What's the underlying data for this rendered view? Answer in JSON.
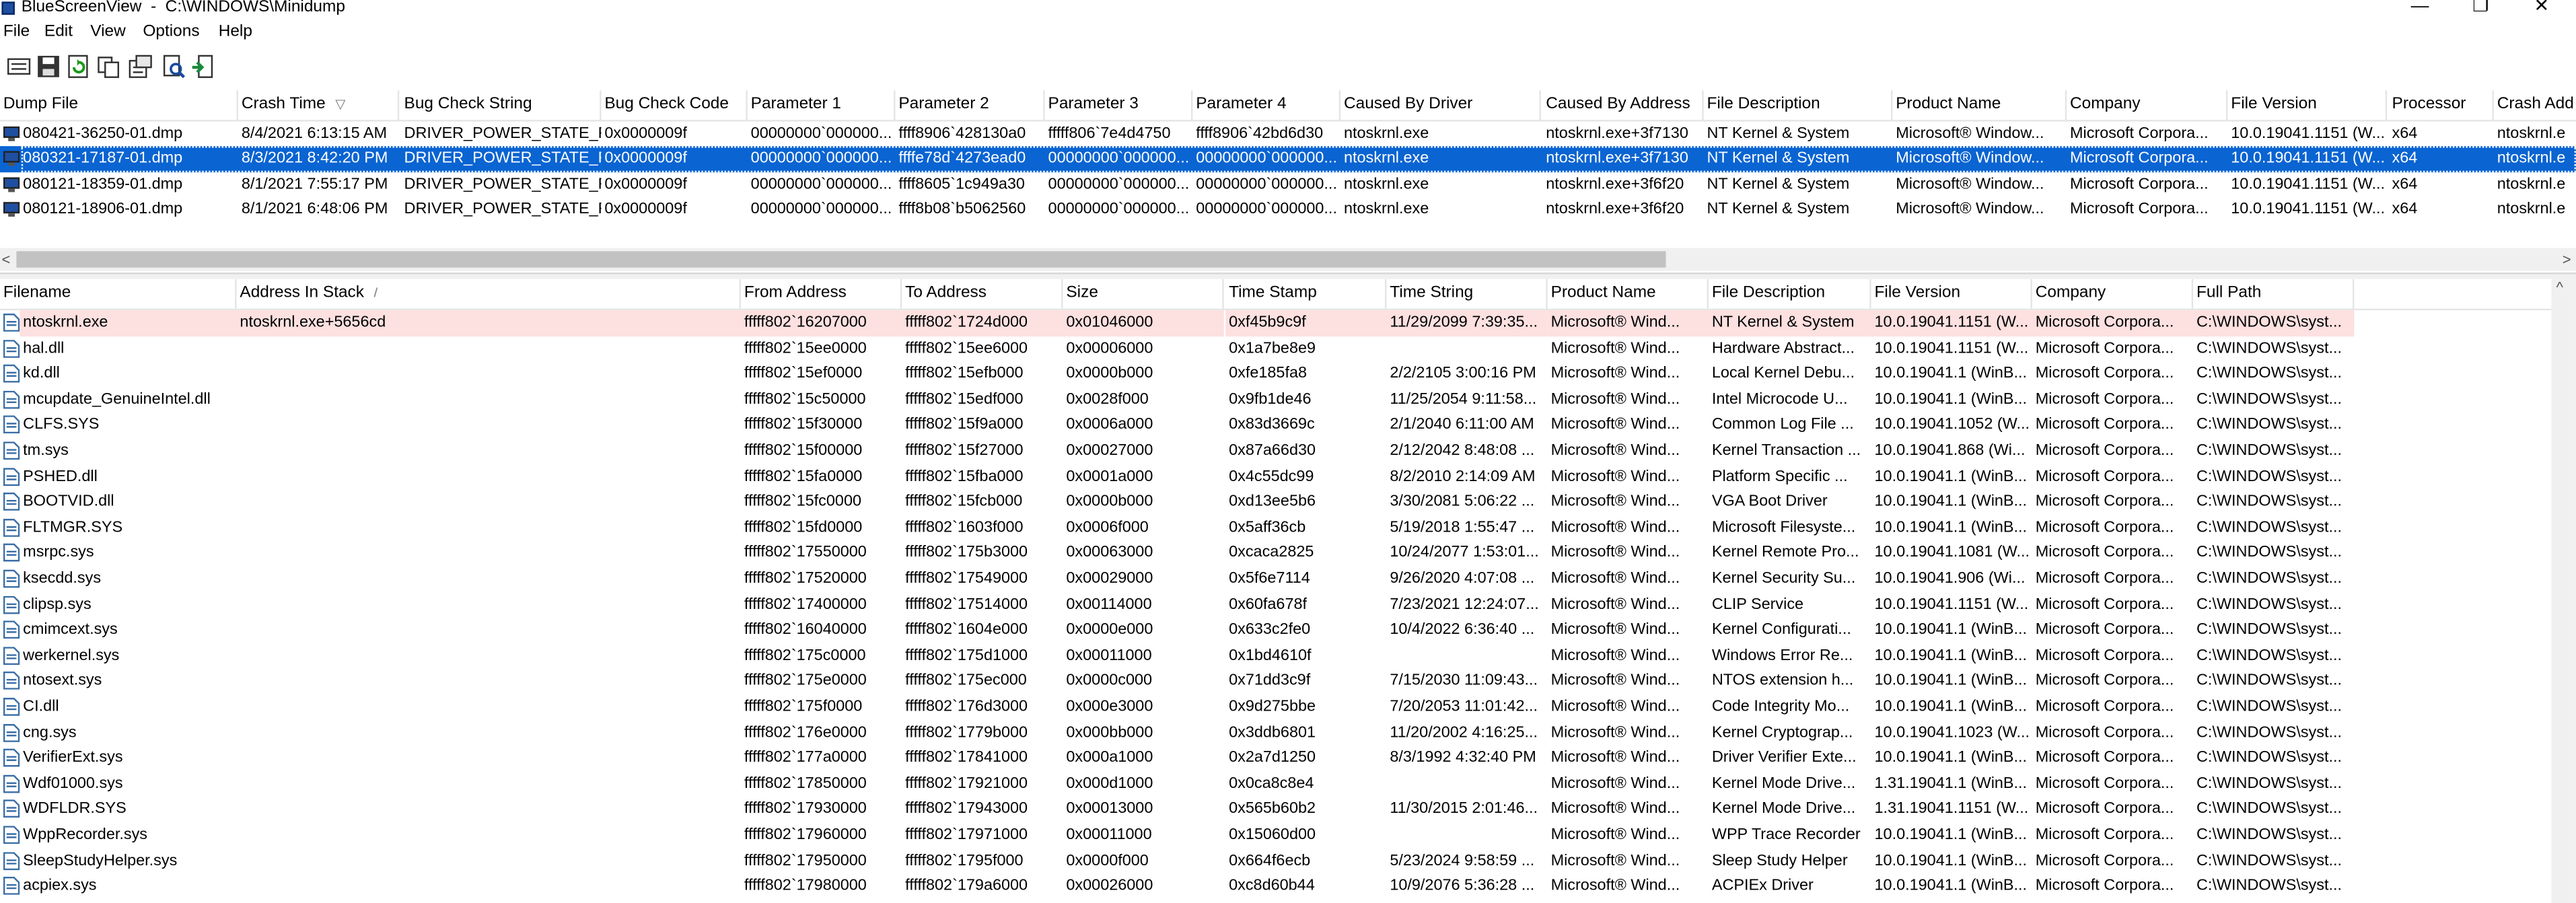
{
  "window": {
    "title": "BlueScreenView  -  C:\\WINDOWS\\Minidump",
    "minimize": "—",
    "maximize": "❐",
    "close": "✕"
  },
  "menu": [
    "File",
    "Edit",
    "View",
    "Options",
    "Help"
  ],
  "toolbar": [
    "html-report-icon",
    "save-icon",
    "refresh-icon",
    "copy-icon",
    "properties-icon",
    "find-icon",
    "exit-icon"
  ],
  "dumps": {
    "columns": [
      "Dump File",
      "Crash Time",
      "Bug Check String",
      "Bug Check Code",
      "Parameter 1",
      "Parameter 2",
      "Parameter 3",
      "Parameter 4",
      "Caused By Driver",
      "Caused By Address",
      "File Description",
      "Product Name",
      "Company",
      "File Version",
      "Processor",
      "Crash Add"
    ],
    "sort_column": "Crash Time",
    "sort_marker": "▽",
    "selected_index": 1,
    "rows": [
      [
        "080421-36250-01.dmp",
        "8/4/2021 6:13:15 AM",
        "DRIVER_POWER_STATE_F...",
        "0x0000009f",
        "00000000`000000...",
        "ffff8906`428130a0",
        "fffff806`7e4d4750",
        "ffff8906`42bd6d30",
        "ntoskrnl.exe",
        "ntoskrnl.exe+3f7130",
        "NT Kernel & System",
        "Microsoft® Window...",
        "Microsoft Corpora...",
        "10.0.19041.1151 (W...",
        "x64",
        "ntoskrnl.e"
      ],
      [
        "080321-17187-01.dmp",
        "8/3/2021 8:42:20 PM",
        "DRIVER_POWER_STATE_F...",
        "0x0000009f",
        "00000000`000000...",
        "ffffe78d`4273ead0",
        "00000000`000000...",
        "00000000`000000...",
        "ntoskrnl.exe",
        "ntoskrnl.exe+3f7130",
        "NT Kernel & System",
        "Microsoft® Window...",
        "Microsoft Corpora...",
        "10.0.19041.1151 (W...",
        "x64",
        "ntoskrnl.e"
      ],
      [
        "080121-18359-01.dmp",
        "8/1/2021 7:55:17 PM",
        "DRIVER_POWER_STATE_F...",
        "0x0000009f",
        "00000000`000000...",
        "ffff8605`1c949a30",
        "00000000`000000...",
        "00000000`000000...",
        "ntoskrnl.exe",
        "ntoskrnl.exe+3f6f20",
        "NT Kernel & System",
        "Microsoft® Window...",
        "Microsoft Corpora...",
        "10.0.19041.1151 (W...",
        "x64",
        "ntoskrnl.e"
      ],
      [
        "080121-18906-01.dmp",
        "8/1/2021 6:48:06 PM",
        "DRIVER_POWER_STATE_F...",
        "0x0000009f",
        "00000000`000000...",
        "ffff8b08`b5062560",
        "00000000`000000...",
        "00000000`000000...",
        "ntoskrnl.exe",
        "ntoskrnl.exe+3f6f20",
        "NT Kernel & System",
        "Microsoft® Window...",
        "Microsoft Corpora...",
        "10.0.19041.1151 (W...",
        "x64",
        "ntoskrnl.e"
      ]
    ]
  },
  "modules": {
    "columns": [
      "Filename",
      "Address In Stack",
      "From Address",
      "To Address",
      "Size",
      "Time Stamp",
      "Time String",
      "Product Name",
      "File Description",
      "File Version",
      "Company",
      "Full Path"
    ],
    "sort_column": "Address In Stack",
    "sort_marker": "/",
    "highlight_color": "#fde0e0",
    "rows": [
      [
        "ntoskrnl.exe",
        "ntoskrnl.exe+5656cd",
        "fffff802`16207000",
        "fffff802`1724d000",
        "0x01046000",
        "0xf45b9c9f",
        "11/29/2099 7:39:35...",
        "Microsoft® Wind...",
        "NT Kernel & System",
        "10.0.19041.1151 (W...",
        "Microsoft Corpora...",
        "C:\\WINDOWS\\syst..."
      ],
      [
        "hal.dll",
        "",
        "fffff802`15ee0000",
        "fffff802`15ee6000",
        "0x00006000",
        "0x1a7be8e9",
        "",
        "Microsoft® Wind...",
        "Hardware Abstract...",
        "10.0.19041.1151 (W...",
        "Microsoft Corpora...",
        "C:\\WINDOWS\\syst..."
      ],
      [
        "kd.dll",
        "",
        "fffff802`15ef0000",
        "fffff802`15efb000",
        "0x0000b000",
        "0xfe185fa8",
        "2/2/2105 3:00:16 PM",
        "Microsoft® Wind...",
        "Local Kernel Debu...",
        "10.0.19041.1 (WinB...",
        "Microsoft Corpora...",
        "C:\\WINDOWS\\syst..."
      ],
      [
        "mcupdate_GenuineIntel.dll",
        "",
        "fffff802`15c50000",
        "fffff802`15edf000",
        "0x0028f000",
        "0x9fb1de46",
        "11/25/2054 9:11:58...",
        "Microsoft® Wind...",
        "Intel Microcode U...",
        "10.0.19041.1 (WinB...",
        "Microsoft Corpora...",
        "C:\\WINDOWS\\syst..."
      ],
      [
        "CLFS.SYS",
        "",
        "fffff802`15f30000",
        "fffff802`15f9a000",
        "0x0006a000",
        "0x83d3669c",
        "2/1/2040 6:11:00 AM",
        "Microsoft® Wind...",
        "Common Log File ...",
        "10.0.19041.1052 (W...",
        "Microsoft Corpora...",
        "C:\\WINDOWS\\syst..."
      ],
      [
        "tm.sys",
        "",
        "fffff802`15f00000",
        "fffff802`15f27000",
        "0x00027000",
        "0x87a66d30",
        "2/12/2042 8:48:08 ...",
        "Microsoft® Wind...",
        "Kernel Transaction ...",
        "10.0.19041.868 (Wi...",
        "Microsoft Corpora...",
        "C:\\WINDOWS\\syst..."
      ],
      [
        "PSHED.dll",
        "",
        "fffff802`15fa0000",
        "fffff802`15fba000",
        "0x0001a000",
        "0x4c55dc99",
        "8/2/2010 2:14:09 AM",
        "Microsoft® Wind...",
        "Platform Specific ...",
        "10.0.19041.1 (WinB...",
        "Microsoft Corpora...",
        "C:\\WINDOWS\\syst..."
      ],
      [
        "BOOTVID.dll",
        "",
        "fffff802`15fc0000",
        "fffff802`15fcb000",
        "0x0000b000",
        "0xd13ee5b6",
        "3/30/2081 5:06:22 ...",
        "Microsoft® Wind...",
        "VGA Boot Driver",
        "10.0.19041.1 (WinB...",
        "Microsoft Corpora...",
        "C:\\WINDOWS\\syst..."
      ],
      [
        "FLTMGR.SYS",
        "",
        "fffff802`15fd0000",
        "fffff802`1603f000",
        "0x0006f000",
        "0x5aff36cb",
        "5/19/2018 1:55:47 ...",
        "Microsoft® Wind...",
        "Microsoft Filesyste...",
        "10.0.19041.1 (WinB...",
        "Microsoft Corpora...",
        "C:\\WINDOWS\\syst..."
      ],
      [
        "msrpc.sys",
        "",
        "fffff802`17550000",
        "fffff802`175b3000",
        "0x00063000",
        "0xcaca2825",
        "10/24/2077 1:53:01...",
        "Microsoft® Wind...",
        "Kernel Remote Pro...",
        "10.0.19041.1081 (W...",
        "Microsoft Corpora...",
        "C:\\WINDOWS\\syst..."
      ],
      [
        "ksecdd.sys",
        "",
        "fffff802`17520000",
        "fffff802`17549000",
        "0x00029000",
        "0x5f6e7114",
        "9/26/2020 4:07:08 ...",
        "Microsoft® Wind...",
        "Kernel Security Su...",
        "10.0.19041.906 (Wi...",
        "Microsoft Corpora...",
        "C:\\WINDOWS\\syst..."
      ],
      [
        "clipsp.sys",
        "",
        "fffff802`17400000",
        "fffff802`17514000",
        "0x00114000",
        "0x60fa678f",
        "7/23/2021 12:24:07...",
        "Microsoft® Wind...",
        "CLIP Service",
        "10.0.19041.1151 (W...",
        "Microsoft Corpora...",
        "C:\\WINDOWS\\syst..."
      ],
      [
        "cmimcext.sys",
        "",
        "fffff802`16040000",
        "fffff802`1604e000",
        "0x0000e000",
        "0x633c2fe0",
        "10/4/2022 6:36:40 ...",
        "Microsoft® Wind...",
        "Kernel Configurati...",
        "10.0.19041.1 (WinB...",
        "Microsoft Corpora...",
        "C:\\WINDOWS\\syst..."
      ],
      [
        "werkernel.sys",
        "",
        "fffff802`175c0000",
        "fffff802`175d1000",
        "0x00011000",
        "0x1bd4610f",
        "",
        "Microsoft® Wind...",
        "Windows Error Re...",
        "10.0.19041.1 (WinB...",
        "Microsoft Corpora...",
        "C:\\WINDOWS\\syst..."
      ],
      [
        "ntosext.sys",
        "",
        "fffff802`175e0000",
        "fffff802`175ec000",
        "0x0000c000",
        "0x71dd3c9f",
        "7/15/2030 11:09:43...",
        "Microsoft® Wind...",
        "NTOS extension h...",
        "10.0.19041.1 (WinB...",
        "Microsoft Corpora...",
        "C:\\WINDOWS\\syst..."
      ],
      [
        "CI.dll",
        "",
        "fffff802`175f0000",
        "fffff802`176d3000",
        "0x000e3000",
        "0x9d275bbe",
        "7/20/2053 11:01:42...",
        "Microsoft® Wind...",
        "Code Integrity Mo...",
        "10.0.19041.1 (WinB...",
        "Microsoft Corpora...",
        "C:\\WINDOWS\\syst..."
      ],
      [
        "cng.sys",
        "",
        "fffff802`176e0000",
        "fffff802`1779b000",
        "0x000bb000",
        "0x3ddb6801",
        "11/20/2002 4:16:25...",
        "Microsoft® Wind...",
        "Kernel Cryptograp...",
        "10.0.19041.1023 (W...",
        "Microsoft Corpora...",
        "C:\\WINDOWS\\syst..."
      ],
      [
        "VerifierExt.sys",
        "",
        "fffff802`177a0000",
        "fffff802`17841000",
        "0x000a1000",
        "0x2a7d1250",
        "8/3/1992 4:32:40 PM",
        "Microsoft® Wind...",
        "Driver Verifier Exte...",
        "10.0.19041.1 (WinB...",
        "Microsoft Corpora...",
        "C:\\WINDOWS\\syst..."
      ],
      [
        "Wdf01000.sys",
        "",
        "fffff802`17850000",
        "fffff802`17921000",
        "0x000d1000",
        "0x0ca8c8e4",
        "",
        "Microsoft® Wind...",
        "Kernel Mode Drive...",
        "1.31.19041.1 (WinB...",
        "Microsoft Corpora...",
        "C:\\WINDOWS\\syst..."
      ],
      [
        "WDFLDR.SYS",
        "",
        "fffff802`17930000",
        "fffff802`17943000",
        "0x00013000",
        "0x565b60b2",
        "11/30/2015 2:01:46...",
        "Microsoft® Wind...",
        "Kernel Mode Drive...",
        "1.31.19041.1151 (W...",
        "Microsoft Corpora...",
        "C:\\WINDOWS\\syst..."
      ],
      [
        "WppRecorder.sys",
        "",
        "fffff802`17960000",
        "fffff802`17971000",
        "0x00011000",
        "0x15060d00",
        "",
        "Microsoft® Wind...",
        "WPP Trace Recorder",
        "10.0.19041.1 (WinB...",
        "Microsoft Corpora...",
        "C:\\WINDOWS\\syst..."
      ],
      [
        "SleepStudyHelper.sys",
        "",
        "fffff802`17950000",
        "fffff802`1795f000",
        "0x0000f000",
        "0x664f6ecb",
        "5/23/2024 9:58:59 ...",
        "Microsoft® Wind...",
        "Sleep Study Helper",
        "10.0.19041.1 (WinB...",
        "Microsoft Corpora...",
        "C:\\WINDOWS\\syst..."
      ],
      [
        "acpiex.sys",
        "",
        "fffff802`17980000",
        "fffff802`179a6000",
        "0x00026000",
        "0xc8d60b44",
        "10/9/2076 5:36:28 ...",
        "Microsoft® Wind...",
        "ACPIEx Driver",
        "10.0.19041.1 (WinB...",
        "Microsoft Corpora...",
        "C:\\WINDOWS\\syst..."
      ]
    ]
  },
  "colors": {
    "selection": "#0a64d2",
    "highlight": "#fde0e0"
  }
}
